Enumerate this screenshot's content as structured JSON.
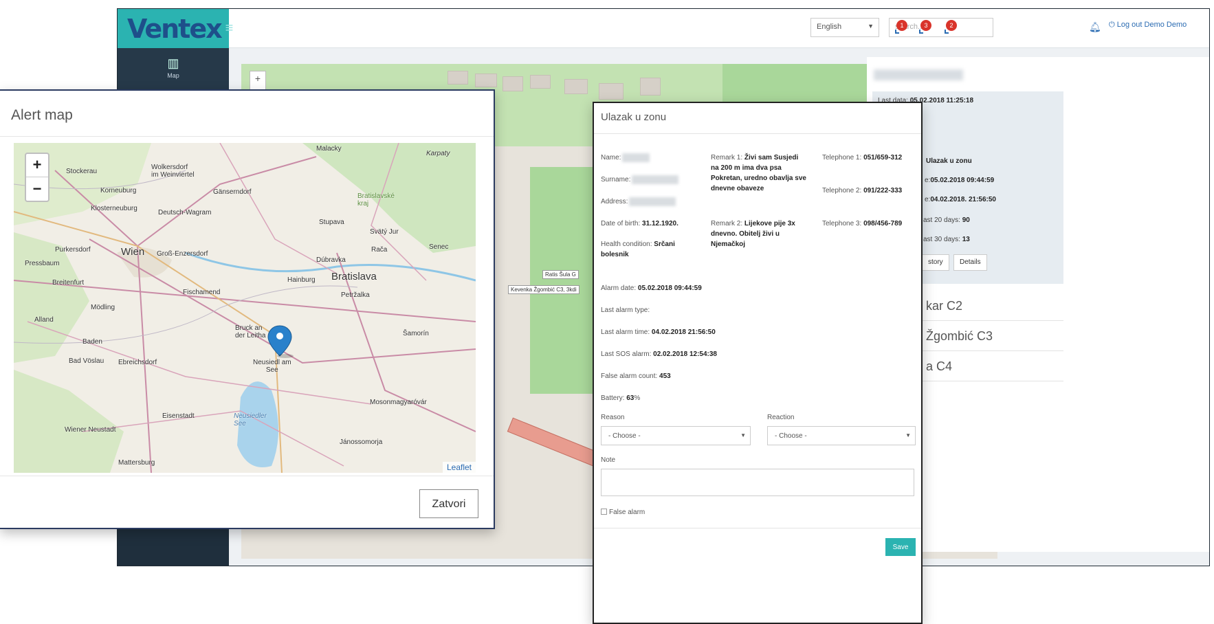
{
  "app": {
    "logo": "Ventex",
    "language": "English",
    "search_placeholder": "search...",
    "notifications": [
      "1",
      "3",
      "2"
    ],
    "logout": "Log out Demo Demo",
    "sidebar": [
      {
        "label": "Map",
        "icon": "map-icon"
      }
    ]
  },
  "background_panel": {
    "last_data": "05.02.2018 11:25:18",
    "last_alarm_type": "Ulazak u zonu",
    "alarm_date": "05.02.2018 09:44:59",
    "last_alarm_time": "04.02.2018. 21:56:50",
    "last20": "90",
    "last30": "13",
    "labels": {
      "last_data": "Last data:",
      "alarm_date": "e:",
      "last_time": "e:",
      "last20": "ast 20 days:",
      "last30": "ast 30 days:"
    },
    "buttons": {
      "history": "story",
      "details": "Details"
    },
    "list_items": [
      "kar C2",
      "Žgombić C3",
      "a C4"
    ],
    "map_labels": [
      "Ratis Šula G",
      "Kevenka Žgombić C3, 3kdi"
    ]
  },
  "alert_map": {
    "title": "Alert map",
    "zoom_in": "+",
    "zoom_out": "−",
    "attribution": "Leaflet",
    "close_button": "Zatvori",
    "cities": {
      "malacky": "Malacky",
      "karpaty": "Karpaty",
      "stockerau": "Stockerau",
      "wolkersdorf": "Wolkersdorf\nim Weinviertel",
      "korneuburg": "Korneuburg",
      "gaenserndorf": "Gänserndorf",
      "bratislavske": "Bratislavské\nkraj",
      "klosterneuburg": "Klosterneuburg",
      "deutsch_wagram": "Deutsch-Wagram",
      "stupava": "Stupava",
      "svaty_jur": "Svätý Jur",
      "purkersdorf": "Purkersdorf",
      "wien": "Wien",
      "gross_enzersdorf": "Groß-Enzersdorf",
      "raca": "Rača",
      "senec": "Senec",
      "pressbaum": "Pressbaum",
      "dubravka": "Dúbravka",
      "breitenfurt": "Breitenfurt",
      "hainburg": "Hainburg",
      "bratislava": "Bratislava",
      "fischamend": "Fischamend",
      "petrzalka": "Petržalka",
      "modling": "Mödling",
      "alland": "Alland",
      "bruck": "Bruck an\nder Leitha",
      "samorin": "Šamorín",
      "baden": "Baden",
      "bad_voslau": "Bad Vöslau",
      "ebreichsdorf": "Ebreichsdorf",
      "neusiedl": "Neusiedl am\nSee",
      "mosonmagyarovar": "Mosonmagyaróvár",
      "eisenstadt": "Eisenstadt",
      "neusiedler_see": "Neusiedler\nSee",
      "wiener_neustadt": "Wiener Neustadt",
      "janossomorja": "Jánossomorja",
      "mattersburg": "Mattersburg"
    }
  },
  "zone_modal": {
    "title": "Ulazak u zonu",
    "name_label": "Name:",
    "surname_label": "Surname:",
    "address_label": "Address:",
    "dob_label": "Date of birth:",
    "dob": "31.12.1920.",
    "health_label": "Health condition:",
    "health": "Srčani bolesnik",
    "remark1_label": "Remark 1:",
    "remark1": "Živi sam Susjedi na 200 m ima dva psa Pokretan, uredno obavlja sve dnevne obaveze",
    "remark2_label": "Remark 2:",
    "remark2": "Lijekove pije 3x dnevno. Obitelj živi u Njemačkoj",
    "tel1_label": "Telephone 1:",
    "tel1": "051/659-312",
    "tel2_label": "Telephone 2:",
    "tel2": "091/222-333",
    "tel3_label": "Telephone 3:",
    "tel3": "098/456-789",
    "alarm_date_label": "Alarm date:",
    "alarm_date": "05.02.2018 09:44:59",
    "last_alarm_type_label": "Last alarm type:",
    "last_alarm_time_label": "Last alarm time:",
    "last_alarm_time": "04.02.2018 21:56:50",
    "last_sos_label": "Last SOS alarm:",
    "last_sos": "02.02.2018 12:54:38",
    "false_count_label": "False alarm count:",
    "false_count": "453",
    "battery_label": "Battery:",
    "battery": "63",
    "battery_unit": "%",
    "reason_label": "Reason",
    "reaction_label": "Reaction",
    "reason_value": "- Choose -",
    "reaction_value": "- Choose -",
    "note_label": "Note",
    "false_alarm_label": "False alarm",
    "save_button": "Save"
  }
}
